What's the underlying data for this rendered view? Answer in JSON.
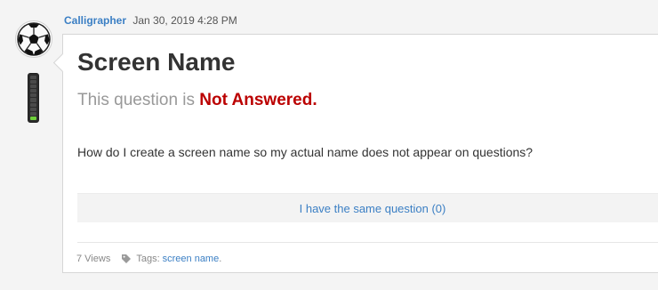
{
  "author": {
    "name": "Calligrapher",
    "posted_at": "Jan 30, 2019 4:28 PM",
    "avatar_icon": "soccer-ball-icon",
    "rank_level": 0.1
  },
  "question": {
    "title": "Screen Name",
    "status_prefix": "This question is",
    "status_value": "Not Answered.",
    "body": "How do I create a screen name so my actual name does not appear on questions?",
    "same_question_label": "I have the same question (0)"
  },
  "footer": {
    "views": "7 Views",
    "tags_label": "Tags:",
    "tags": [
      "screen name"
    ],
    "tags_suffix": "."
  },
  "colors": {
    "link": "#3b7fc4",
    "not_answered": "#bb0000",
    "rank_on": "#6fd03b"
  }
}
